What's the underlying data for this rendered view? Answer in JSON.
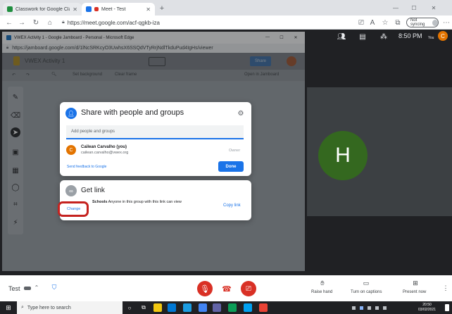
{
  "browser": {
    "tabs": [
      {
        "title": "Classwork for Google Classroom",
        "active": false
      },
      {
        "title": "Meet - Test",
        "active": true
      }
    ],
    "new_tab": "+",
    "url": "https://meet.google.com/acf-qgkb-iza",
    "sync_label": "Not syncing"
  },
  "meet_header": {
    "time": "8:50 PM",
    "you_label": "You",
    "avatar_initial": "C"
  },
  "jamboard_window": {
    "title": "VWEX Activity 1 - Google Jamboard - Personal - Microsoft Edge",
    "url": "https://jamboard.google.com/d/1lNcSRKcyO3UwhsX6SSQdVTyRrjNdlTkduPud4IgHs/viewer",
    "minimize": "—",
    "maximize": "☐",
    "close": "✕",
    "doc_title": "VWEX Activity 1",
    "share_button": "Share",
    "set_background": "Set background",
    "clear_frame": "Clear frame",
    "open_jamboard": "Open in Jamboard"
  },
  "share_dialog": {
    "title": "Share with people and groups",
    "input_placeholder": "Add people and groups",
    "person_name": "Cailean Carvalho (you)",
    "person_email": "cailean.carvalho@vwex.org",
    "person_initial": "C",
    "role": "Owner",
    "feedback_link": "Send feedback to Google",
    "done_button": "Done"
  },
  "link_dialog": {
    "title": "Get link",
    "access_prefix": "Schools",
    "access_desc": "Anyone in this group with this link can view",
    "change_button": "Change",
    "copy_button": "Copy link"
  },
  "participant": {
    "initial": "H"
  },
  "call_controls": {
    "meeting_name": "Test",
    "raise_hand": "Raise hand",
    "captions": "Turn on captions",
    "present": "Present now"
  },
  "taskbar": {
    "search_placeholder": "Type here to search",
    "time": "20:50",
    "date": "03/02/2021"
  },
  "colors": {
    "accent": "#1a73e8",
    "end_call": "#d93025",
    "highlight": "#c5221f",
    "avatar_green": "#34681f"
  }
}
